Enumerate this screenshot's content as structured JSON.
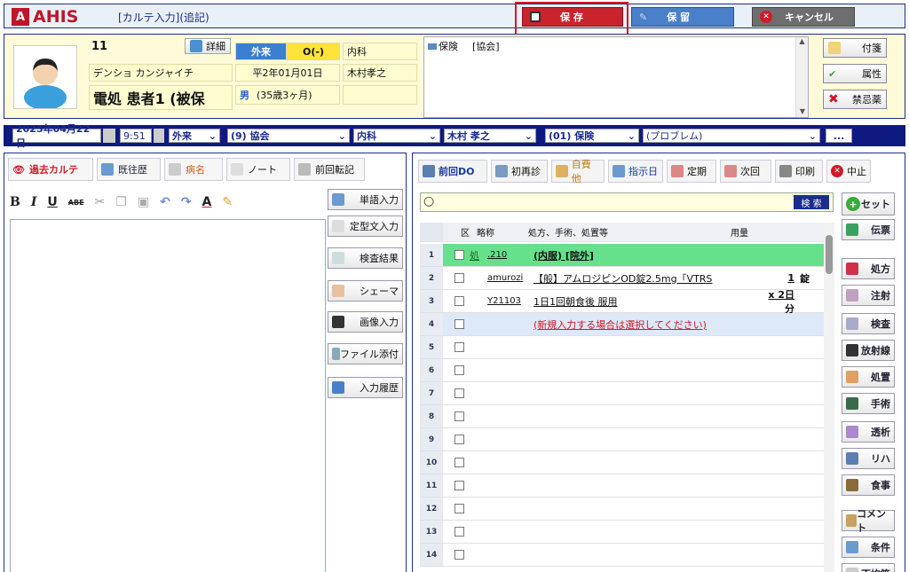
{
  "app": {
    "logo": "AHIS",
    "logo_mark": "A",
    "mode": "[カルテ入力](追記)"
  },
  "toolbar": {
    "save": "保 存",
    "hold": "保 留",
    "cancel": "キャンセル"
  },
  "patient": {
    "id": "11",
    "detail_button": "詳細",
    "visit_type": "外来",
    "visit_code": "O(-)",
    "department": "内科",
    "kana": "デンショ カンジャイチ",
    "birthdate": "平2年01月01日",
    "doctor": "木村孝之",
    "name": "電処 患者1 (被保",
    "sex": "男",
    "age": "(35歳3ヶ月)",
    "insurance_label": "保険",
    "insurance_value": "[協会]"
  },
  "side_buttons": [
    "付箋",
    "属性",
    "禁忌薬"
  ],
  "infobar": {
    "date": "2025年04月22日",
    "time": "9:51",
    "visit": "外来",
    "insurer": "(9) 協会",
    "dept": "内科",
    "doctor": "木村 孝之",
    "insurance": "(01) 保険",
    "problem": "(プロブレム)",
    "more": "..."
  },
  "left": {
    "tools": [
      "過去カルテ",
      "既往歴",
      "病名",
      "ノート",
      "前回転記"
    ],
    "format": {
      "bold": "B",
      "italic": "I",
      "underline": "U",
      "strike": "ABE",
      "font_color": "A"
    },
    "right_buttons": [
      "単語入力",
      "定型文入力",
      "検査結果",
      "シェーマ",
      "画像入力",
      "ファイル添付",
      "入力履歴"
    ]
  },
  "right": {
    "tools": [
      "前回DO",
      "初再診",
      "自費他",
      "指示日",
      "定期",
      "次回",
      "印刷",
      "中止"
    ],
    "search_button": "検 索",
    "headers": {
      "kubun": "区",
      "ryaku": "略称",
      "content": "処方、手術、処置等",
      "amount": "用量"
    },
    "rows": [
      {
        "num": "1",
        "kubun": "処",
        "code": ".210",
        "content": "(内服) [院外]",
        "amount": "",
        "unit": ""
      },
      {
        "num": "2",
        "kubun": "",
        "code": "amurozi",
        "content": "【般】アムロジピンOD錠2.5mg「VTRS",
        "amount": "1",
        "unit": "錠"
      },
      {
        "num": "3",
        "kubun": "",
        "code": "Y21103",
        "content": "1日1回朝食後 服用",
        "amount": "x 2日分",
        "unit": ""
      },
      {
        "num": "4",
        "kubun": "",
        "code": "",
        "content": "(新規入力する場合は選択してください)",
        "amount": "",
        "unit": ""
      },
      {
        "num": "5"
      },
      {
        "num": "6"
      },
      {
        "num": "7"
      },
      {
        "num": "8"
      },
      {
        "num": "9"
      },
      {
        "num": "10"
      },
      {
        "num": "11"
      },
      {
        "num": "12"
      },
      {
        "num": "13"
      },
      {
        "num": "14"
      }
    ],
    "set_button": "セット",
    "side_buttons": [
      "伝票",
      "処方",
      "注射",
      "検査",
      "放射線",
      "処置",
      "手術",
      "透析",
      "リハ",
      "食事",
      "コメント",
      "条件",
      "不均等"
    ]
  },
  "colors": {
    "accent": "#1c2e8c",
    "save": "#c9232d",
    "hold": "#4a7fc9",
    "row_green": "#66e08a",
    "highlight_row": "#dde8f8"
  }
}
